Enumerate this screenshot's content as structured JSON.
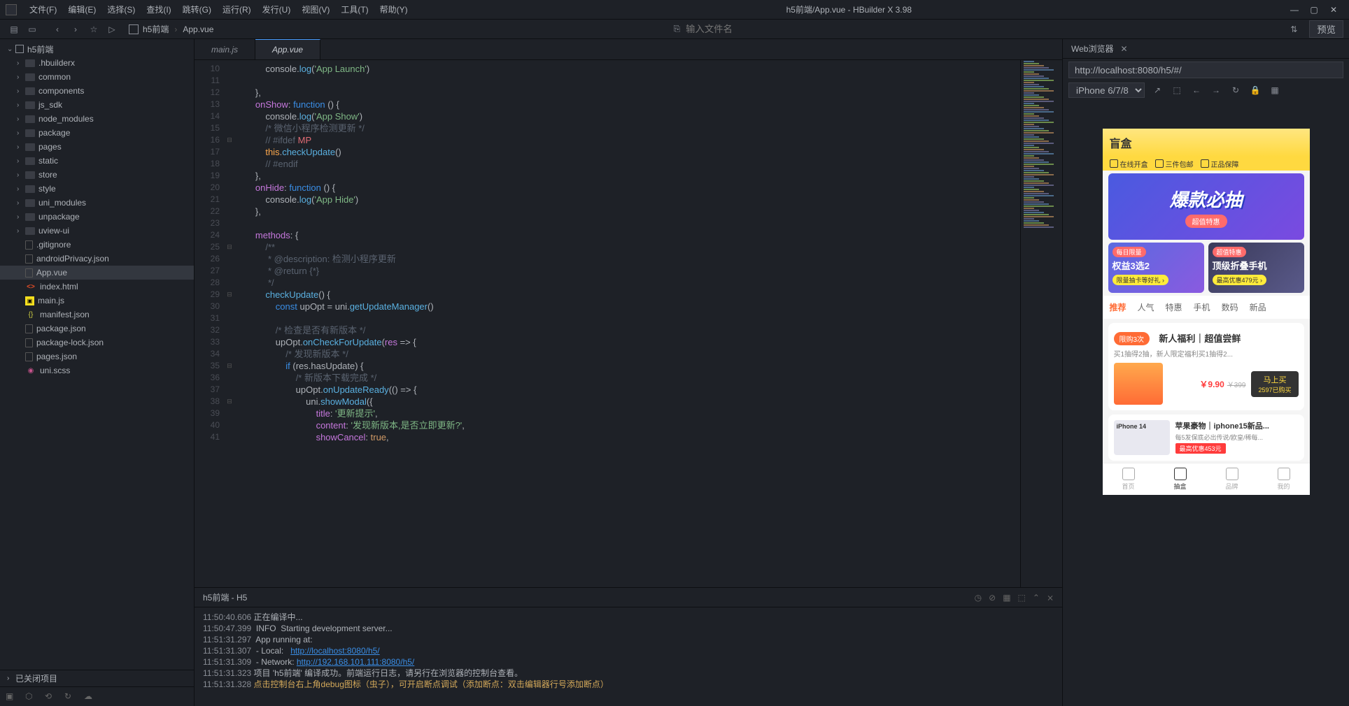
{
  "window_title": "h5前端/App.vue - HBuilder X 3.98",
  "menu": [
    "文件(F)",
    "编辑(E)",
    "选择(S)",
    "查找(I)",
    "跳转(G)",
    "运行(R)",
    "发行(U)",
    "视图(V)",
    "工具(T)",
    "帮助(Y)"
  ],
  "toolbar": {
    "crumb_project": "h5前端",
    "crumb_file": "App.vue",
    "search_placeholder": "输入文件名",
    "preview_btn": "预览"
  },
  "sidebar": {
    "project": "h5前端",
    "folders": [
      ".hbuilderx",
      "common",
      "components",
      "js_sdk",
      "node_modules",
      "package",
      "pages",
      "static",
      "store",
      "style",
      "uni_modules",
      "unpackage",
      "uview-ui"
    ],
    "files": [
      {
        "name": ".gitignore",
        "icon": "file"
      },
      {
        "name": "androidPrivacy.json",
        "icon": "file"
      },
      {
        "name": "App.vue",
        "icon": "file"
      },
      {
        "name": "index.html",
        "icon": "html"
      },
      {
        "name": "main.js",
        "icon": "js"
      },
      {
        "name": "manifest.json",
        "icon": "json"
      },
      {
        "name": "package.json",
        "icon": "file"
      },
      {
        "name": "package-lock.json",
        "icon": "file"
      },
      {
        "name": "pages.json",
        "icon": "file"
      },
      {
        "name": "uni.scss",
        "icon": "scss"
      }
    ],
    "closed_label": "已关闭项目"
  },
  "tabs": [
    "main.js",
    "App.vue"
  ],
  "active_tab": 1,
  "code_lines": [
    {
      "n": 10,
      "html": "            console.<span class='fnname'>log</span>(<span class='str'>'App Launch'</span>)"
    },
    {
      "n": 11,
      "html": ""
    },
    {
      "n": 12,
      "html": "        },"
    },
    {
      "n": 13,
      "html": "        <span class='prop'>onShow</span>: <span class='kw'>function</span> () {"
    },
    {
      "n": 14,
      "html": "            console.<span class='fnname'>log</span>(<span class='str'>'App Show'</span>)"
    },
    {
      "n": 15,
      "html": "            <span class='cmt'>/* 微信小程序检测更新 */</span>"
    },
    {
      "n": 16,
      "fold": "⊟",
      "html": "            <span class='cmt'>// #ifdef</span> <span style='color:#e06c75'>MP</span>"
    },
    {
      "n": 17,
      "html": "            <span class='this'>this</span>.<span class='fnname'>checkUpdate</span>()"
    },
    {
      "n": 18,
      "html": "            <span class='cmt'>// #endif</span>"
    },
    {
      "n": 19,
      "html": "        },"
    },
    {
      "n": 20,
      "html": "        <span class='prop'>onHide</span>: <span class='kw'>function</span> () {"
    },
    {
      "n": 21,
      "html": "            console.<span class='fnname'>log</span>(<span class='str'>'App Hide'</span>)"
    },
    {
      "n": 22,
      "html": "        },"
    },
    {
      "n": 23,
      "html": ""
    },
    {
      "n": 24,
      "html": "        <span class='prop'>methods</span>: {"
    },
    {
      "n": 25,
      "fold": "⊟",
      "html": "            <span class='cmt'>/**</span>"
    },
    {
      "n": 26,
      "html": "<span class='cmt'>             * @description: 检测小程序更新</span>"
    },
    {
      "n": 27,
      "html": "<span class='cmt'>             * @return {*}</span>"
    },
    {
      "n": 28,
      "html": "<span class='cmt'>             */</span>"
    },
    {
      "n": 29,
      "fold": "⊟",
      "html": "            <span class='fnname'>checkUpdate</span>() {"
    },
    {
      "n": 30,
      "html": "                <span class='kw'>const</span> upOpt = uni.<span class='fnname'>getUpdateManager</span>()"
    },
    {
      "n": 31,
      "html": ""
    },
    {
      "n": 32,
      "html": "                <span class='cmt'>/* 检查是否有新版本 */</span>"
    },
    {
      "n": 33,
      "html": "                upOpt.<span class='fnname'>onCheckForUpdate</span>(<span class='prop'>res</span> => {"
    },
    {
      "n": 34,
      "html": "                    <span class='cmt'>/* 发现新版本 */</span>"
    },
    {
      "n": 35,
      "fold": "⊟",
      "html": "                    <span class='kw'>if</span> (res.hasUpdate) {"
    },
    {
      "n": 36,
      "html": "                        <span class='cmt'>/* 新版本下载完成 */</span>"
    },
    {
      "n": 37,
      "html": "                        upOpt.<span class='fnname'>onUpdateReady</span>(() => {"
    },
    {
      "n": 38,
      "fold": "⊟",
      "html": "                            uni.<span class='fnname'>showModal</span>({"
    },
    {
      "n": 39,
      "html": "                                <span class='prop'>title</span>: <span class='str'>'更新提示'</span>,"
    },
    {
      "n": 40,
      "html": "                                <span class='prop'>content</span>: <span class='str'>'发现新版本,是否立即更新?'</span>,"
    },
    {
      "n": 41,
      "html": "                                <span class='prop'>showCancel</span>: <span class='num'>true</span>,"
    }
  ],
  "console": {
    "title": "h5前端 - H5",
    "lines": [
      {
        "ts": "11:50:40.606",
        "text": "正在编译中..."
      },
      {
        "ts": "11:50:47.399",
        "text": " INFO  Starting development server..."
      },
      {
        "ts": "11:51:31.297",
        "text": " App running at:"
      },
      {
        "ts": "11:51:31.307",
        "text": " - Local:   ",
        "link": "http://localhost:8080/h5/"
      },
      {
        "ts": "11:51:31.309",
        "text": " - Network: ",
        "link": "http://192.168.101.111:8080/h5/"
      },
      {
        "ts": "11:51:31.323",
        "text": "项目 'h5前端' 编译成功。前端运行日志，请另行在浏览器的控制台查看。"
      },
      {
        "ts": "11:51:31.328",
        "warn": true,
        "text": "点击控制台右上角debug图标（虫子），可开启断点调试（添加断点：双击编辑器行号添加断点）"
      }
    ]
  },
  "preview": {
    "tab_title": "Web浏览器",
    "url": "http://localhost:8080/h5/#/",
    "device": "iPhone 6/7/8"
  },
  "phone": {
    "logo": "盲盒",
    "features": [
      "在线开盒",
      "三件包邮",
      "正品保障"
    ],
    "banner_text": "爆款必抽",
    "banner_tag": "超值特惠",
    "card1": {
      "tag": "每日限量",
      "title": "权益3选2",
      "sub": "限量抽卡等好礼 ›"
    },
    "card2": {
      "tag": "超值特惠",
      "title": "顶级折叠手机",
      "sub": "最高优惠479元 ›"
    },
    "tabs": [
      "推荐",
      "人气",
      "特惠",
      "手机",
      "数码",
      "新品"
    ],
    "product1": {
      "badge": "限购3次",
      "title": "新人福利｜超值尝鲜",
      "sub": "买1抽得2抽，新人限定福利买1抽得2...",
      "price": "￥9.90",
      "old_price": "￥399",
      "buy_btn": "马上买",
      "buy_count": "2597已购买"
    },
    "product2": {
      "img_label": "iPhone 14",
      "title": "苹果豪物｜iphone15新品...",
      "sub": "每5发保底必出传说/欧皇/稀每...",
      "badge": "最高优惠453元"
    },
    "nav": [
      "首页",
      "抽盒",
      "品牌",
      "我的"
    ]
  }
}
